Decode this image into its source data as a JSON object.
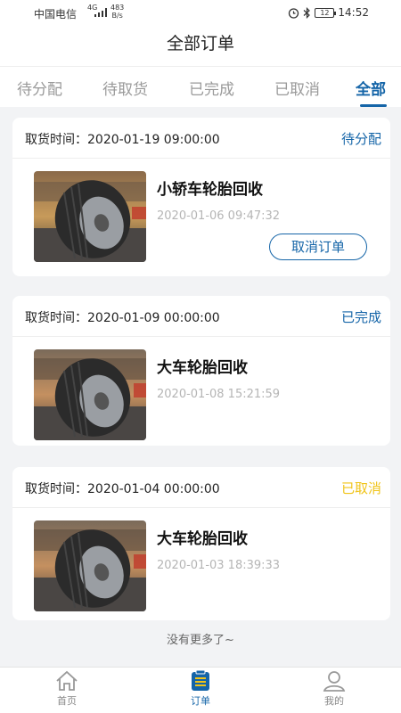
{
  "status_bar": {
    "carrier": "中国电信",
    "network": "4G",
    "speed_value": "483",
    "speed_unit": "B/s",
    "battery": "12",
    "time": "14:52"
  },
  "title": "全部订单",
  "tabs": [
    {
      "label": "待分配"
    },
    {
      "label": "待取货"
    },
    {
      "label": "已完成"
    },
    {
      "label": "已取消"
    },
    {
      "label": "全部"
    }
  ],
  "active_tab": "全部",
  "orders": [
    {
      "pickup": "取货时间：2020-01-19 09:00:00",
      "status": "待分配",
      "status_color": "#1565a8",
      "product": "小轿车轮胎回收",
      "created": "2020-01-06 09:47:32",
      "action": "取消订单"
    },
    {
      "pickup": "取货时间：2020-01-09 00:00:00",
      "status": "已完成",
      "status_color": "#1565a8",
      "product": "大车轮胎回收",
      "created": "2020-01-08 15:21:59"
    },
    {
      "pickup": "取货时间：2020-01-04 00:00:00",
      "status": "已取消",
      "status_color": "#f0c419",
      "product": "大车轮胎回收",
      "created": "2020-01-03 18:39:33"
    }
  ],
  "no_more": "没有更多了~",
  "nav": [
    {
      "label": "首页",
      "icon": "home-icon"
    },
    {
      "label": "订单",
      "icon": "order-icon"
    },
    {
      "label": "我的",
      "icon": "profile-icon"
    }
  ],
  "colors": {
    "accent": "#1565a8",
    "cancelled": "#f0c419"
  }
}
